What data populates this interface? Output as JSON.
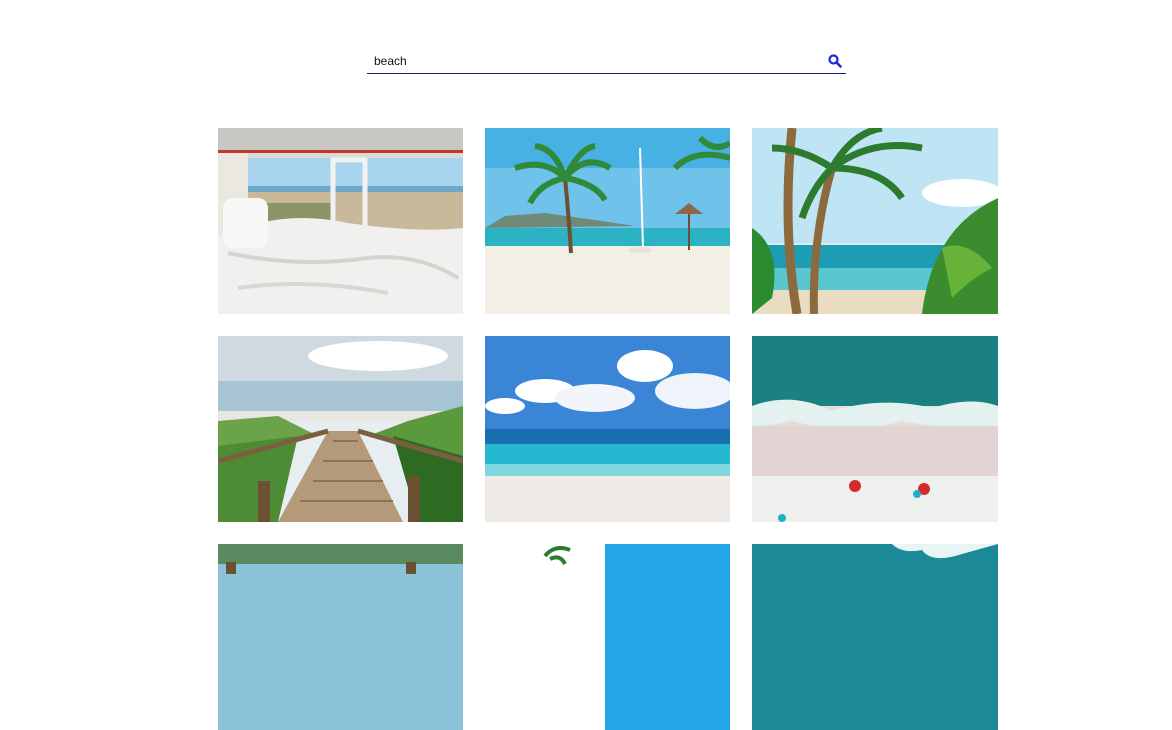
{
  "search": {
    "value": "beach",
    "icon": "search-icon"
  },
  "results": [
    {
      "name": "camper-van-bed-beach-view"
    },
    {
      "name": "palm-tree-beach-umbrella"
    },
    {
      "name": "leaning-palm-trees-sea"
    },
    {
      "name": "wooden-boardwalk-to-beach"
    },
    {
      "name": "turquoise-sea-clouds"
    },
    {
      "name": "aerial-beach-red-umbrellas"
    },
    {
      "name": "beach-row-3-image-1"
    },
    {
      "name": "beach-row-3-image-2"
    },
    {
      "name": "beach-row-3-image-3"
    }
  ],
  "colors": {
    "accent": "#1f2ad6",
    "underline": "#1a1a6e"
  }
}
